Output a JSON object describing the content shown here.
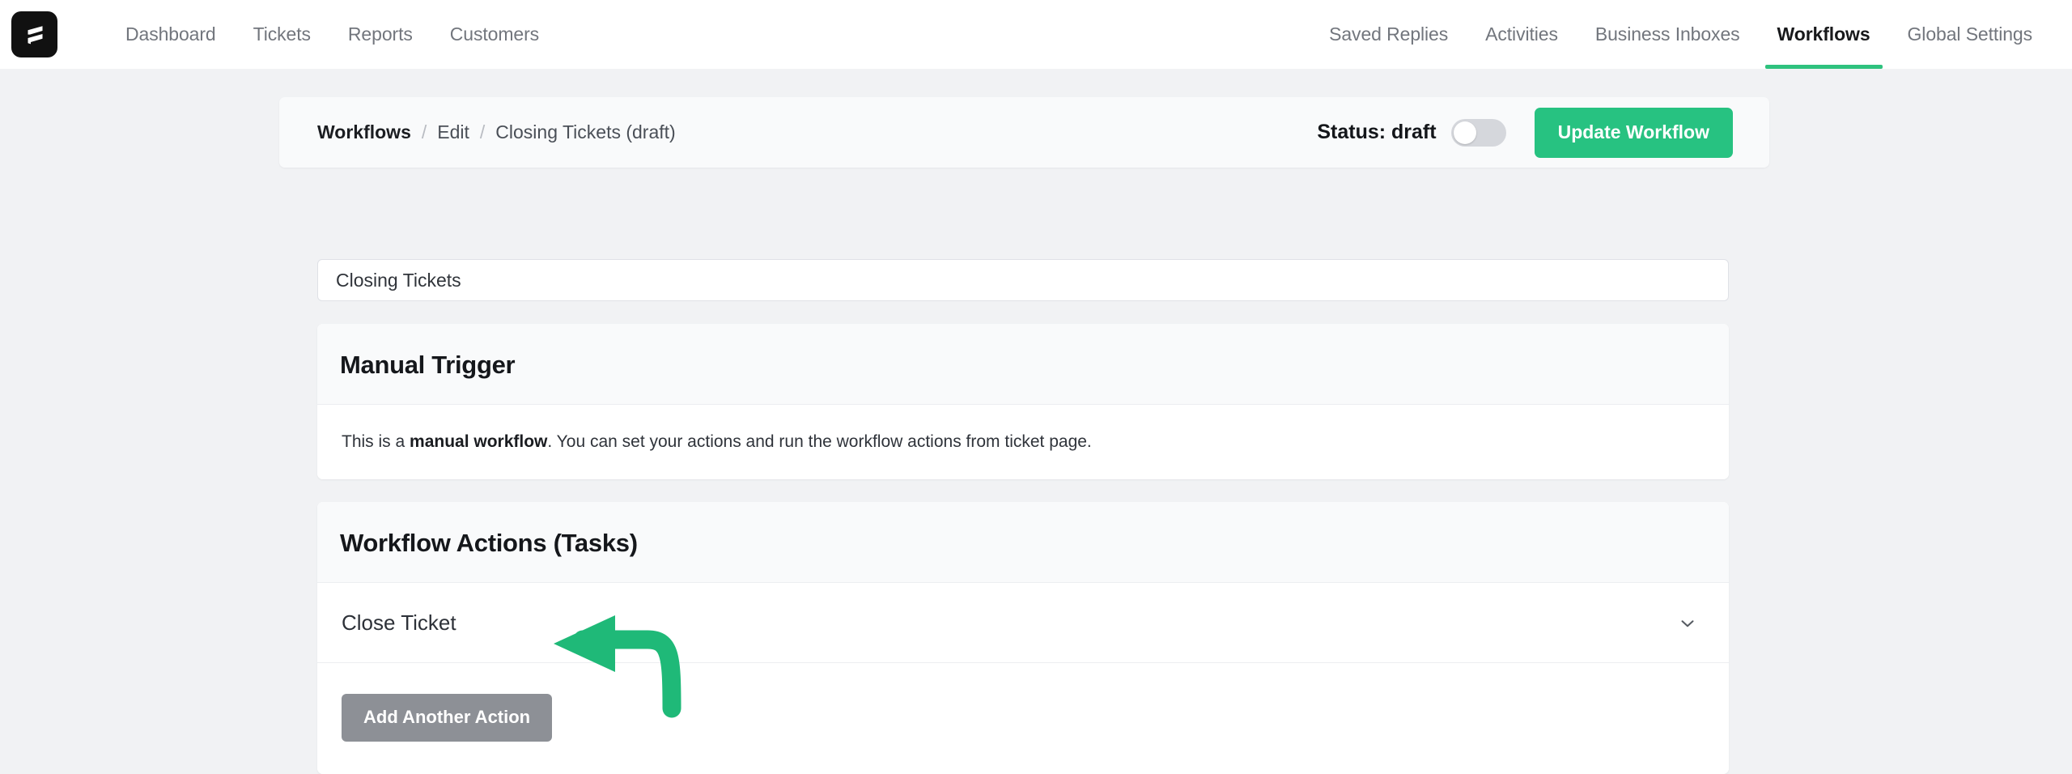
{
  "brand": {
    "logo_icon": "flowchart-logo-icon"
  },
  "nav": {
    "left_items": [
      {
        "label": "Dashboard",
        "active": false
      },
      {
        "label": "Tickets",
        "active": false
      },
      {
        "label": "Reports",
        "active": false
      },
      {
        "label": "Customers",
        "active": false
      }
    ],
    "right_items": [
      {
        "label": "Saved Replies",
        "active": false
      },
      {
        "label": "Activities",
        "active": false
      },
      {
        "label": "Business Inboxes",
        "active": false
      },
      {
        "label": "Workflows",
        "active": true
      },
      {
        "label": "Global Settings",
        "active": false
      }
    ],
    "active_accent": "#2ec27e"
  },
  "header": {
    "breadcrumb": {
      "root": "Workflows",
      "separator": "/",
      "middle": "Edit",
      "current": "Closing Tickets (draft)"
    },
    "status_label": "Status: draft",
    "toggle_state": "off",
    "update_button": "Update Workflow",
    "primary_color": "#27c281"
  },
  "name_field": {
    "value": "Closing Tickets",
    "placeholder": "Workflow name"
  },
  "trigger_card": {
    "title": "Manual Trigger",
    "text_before": "This is a ",
    "text_bold": "manual workflow",
    "text_after": ". You can set your actions and run the workflow actions from ticket page."
  },
  "actions_card": {
    "title": "Workflow Actions (Tasks)",
    "rows": [
      {
        "label": "Close Ticket",
        "expand_icon": "chevron-down-icon"
      }
    ],
    "add_button": "Add Another Action"
  },
  "annotation": {
    "arrow_icon": "curved-arrow-annotation",
    "color": "#1fb978"
  }
}
